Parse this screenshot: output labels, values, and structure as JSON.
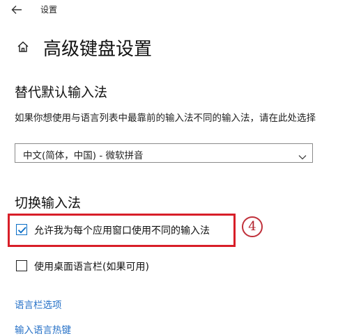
{
  "app": {
    "title": "设置"
  },
  "page": {
    "title": "高级键盘设置"
  },
  "default_input": {
    "heading": "替代默认输入法",
    "description": "如果你想使用与语言列表中最靠前的输入法不同的输入法，请在此处选择",
    "selected": "中文(简体，中国) - 微软拼音"
  },
  "switch_input": {
    "heading": "切换输入法",
    "per_app_label": "允许我为每个应用窗口使用不同的输入法",
    "per_app_checked": true,
    "desktop_bar_label": "使用桌面语言栏(如果可用)",
    "desktop_bar_checked": false
  },
  "annotation": {
    "step": "4",
    "color": "#d81e28"
  },
  "links": {
    "language_bar_options": "语言栏选项",
    "input_language_hotkeys": "输入语言热键"
  },
  "colors": {
    "accent": "#0b6fc7",
    "link": "#2671c7"
  },
  "icons": {
    "back": "arrow-left-icon",
    "home": "home-icon",
    "dropdown": "chevron-down-icon",
    "check": "checkmark-icon"
  }
}
